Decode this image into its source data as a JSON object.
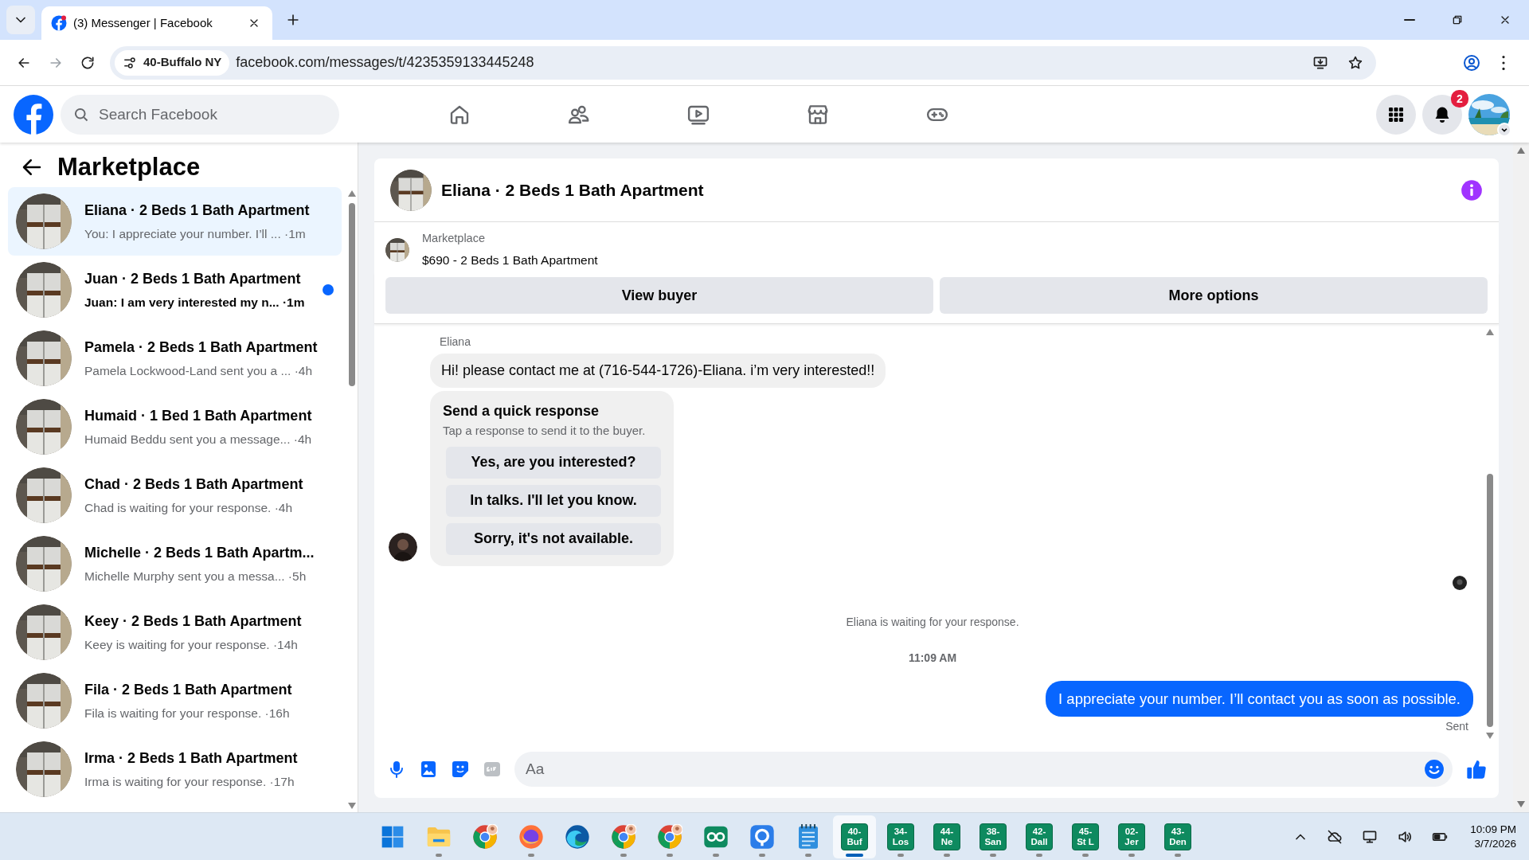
{
  "browser": {
    "tabs": [
      {
        "title": "(3) Messenger | Facebook",
        "selected": true
      }
    ],
    "site_chip": "40-Buffalo NY",
    "url": "facebook.com/messages/t/4235359133445248"
  },
  "header": {
    "search": {
      "placeholder": "Search Facebook"
    },
    "notification_count": "2"
  },
  "sidebar": {
    "title": "Marketplace",
    "conversations": [
      {
        "title": "Eliana · 2 Beds 1 Bath Apartment",
        "preview": "You: I appreciate your number. I’ll ...",
        "time": "·1m",
        "unread": false,
        "selected": true
      },
      {
        "title": "Juan · 2 Beds 1 Bath Apartment",
        "preview": "Juan: I am very interested my n...",
        "time": "·1m",
        "unread": true,
        "selected": false
      },
      {
        "title": "Pamela · 2 Beds 1 Bath Apartment",
        "preview": "Pamela Lockwood-Land sent you a ...",
        "time": "·4h",
        "unread": false,
        "selected": false
      },
      {
        "title": "Humaid · 1 Bed 1 Bath Apartment",
        "preview": "Humaid Beddu sent you a message...",
        "time": "·4h",
        "unread": false,
        "selected": false
      },
      {
        "title": "Chad · 2 Beds 1 Bath Apartment",
        "preview": "Chad is waiting for your response.",
        "time": "·4h",
        "unread": false,
        "selected": false
      },
      {
        "title": "Michelle · 2 Beds 1 Bath Apartm...",
        "preview": "Michelle Murphy sent you a messa...",
        "time": "·5h",
        "unread": false,
        "selected": false
      },
      {
        "title": "Keey · 2 Beds 1 Bath Apartment",
        "preview": "Keey is waiting for your response.",
        "time": "·14h",
        "unread": false,
        "selected": false
      },
      {
        "title": "Fila · 2 Beds 1 Bath Apartment",
        "preview": "Fila is waiting for your response.",
        "time": "·16h",
        "unread": false,
        "selected": false
      },
      {
        "title": "Irma · 2 Beds 1 Bath Apartment",
        "preview": "Irma is waiting for your response.",
        "time": "·17h",
        "unread": false,
        "selected": false
      }
    ]
  },
  "chat": {
    "title": "Eliana · 2 Beds 1 Bath Apartment",
    "listing": {
      "label": "Marketplace",
      "title": "$690 - 2 Beds 1 Bath Apartment"
    },
    "buttons": [
      "View buyer",
      "More options"
    ],
    "sender": "Eliana",
    "incoming": "Hi! please contact me at (716-544-1726)-Eliana. i’m very interested!!",
    "quick_response": {
      "title": "Send a quick response",
      "subtitle": "Tap a response to send it to the buyer.",
      "options": [
        "Yes, are you interested?",
        "In talks. I'll let you know.",
        "Sorry, it's not available."
      ]
    },
    "status": "Eliana is waiting for your response.",
    "time": "11:09 AM",
    "outgoing": "I appreciate your number. I’ll contact you as soon as possible.",
    "delivery": "Sent",
    "composer": {
      "placeholder": "Aa"
    }
  },
  "taskbar": {
    "apps": [
      {
        "kind": "start",
        "running": false,
        "selected": false
      },
      {
        "kind": "files",
        "running": true,
        "selected": false
      },
      {
        "kind": "chrome",
        "running": false,
        "selected": false
      },
      {
        "kind": "firefox",
        "running": true,
        "selected": false
      },
      {
        "kind": "edge",
        "running": false,
        "selected": false
      },
      {
        "kind": "chrome-profile",
        "running": true,
        "selected": false
      },
      {
        "kind": "chrome-profile",
        "running": true,
        "selected": false
      },
      {
        "kind": "app-green",
        "running": true,
        "selected": false
      },
      {
        "kind": "app-blue",
        "running": true,
        "selected": false
      },
      {
        "kind": "notepad",
        "running": true,
        "selected": false
      },
      {
        "kind": "label",
        "line_1": "40-",
        "line_2": "Buf",
        "running": true,
        "selected": true
      },
      {
        "kind": "label",
        "line_1": "34-",
        "line_2": "Los",
        "running": true,
        "selected": false
      },
      {
        "kind": "label",
        "line_1": "44-",
        "line_2": "Ne",
        "running": true,
        "selected": false
      },
      {
        "kind": "label",
        "line_1": "38-",
        "line_2": "San",
        "running": true,
        "selected": false
      },
      {
        "kind": "label",
        "line_1": "42-",
        "line_2": "Dall",
        "running": true,
        "selected": false
      },
      {
        "kind": "label",
        "line_1": "45-",
        "line_2": "St L",
        "running": true,
        "selected": false
      },
      {
        "kind": "label",
        "line_1": "02-",
        "line_2": "Jer",
        "running": true,
        "selected": false
      },
      {
        "kind": "label",
        "line_1": "43-",
        "line_2": "Den",
        "running": true,
        "selected": false
      }
    ],
    "time": "10:09 PM",
    "date": "3/7/2026"
  }
}
